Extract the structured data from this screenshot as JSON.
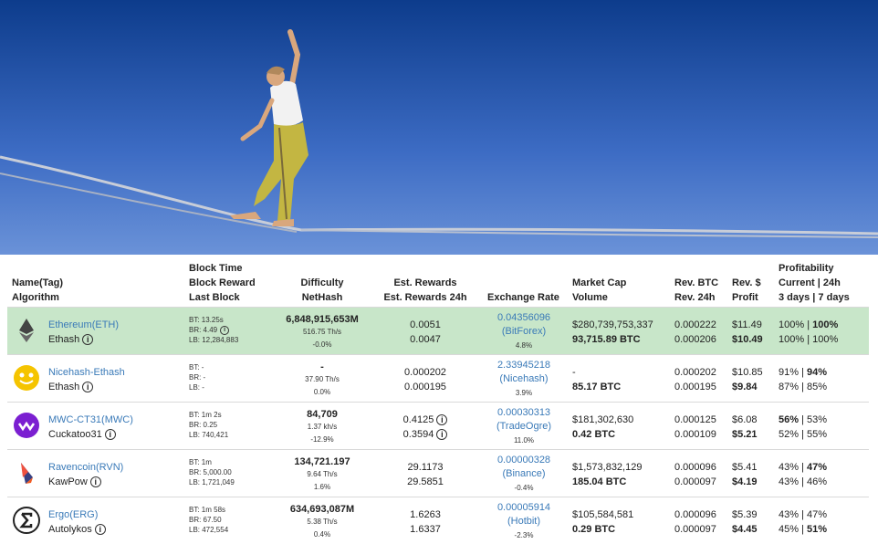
{
  "header": {
    "name_tag": "Name(Tag)",
    "algorithm": "Algorithm",
    "block_time": "Block Time",
    "block_reward": "Block Reward",
    "last_block": "Last Block",
    "difficulty": "Difficulty",
    "nethash": "NetHash",
    "est_rewards": "Est. Rewards",
    "est_rewards_24h": "Est. Rewards 24h",
    "exchange_rate": "Exchange Rate",
    "market_cap": "Market Cap",
    "volume": "Volume",
    "rev_btc": "Rev. BTC",
    "rev_24h": "Rev. 24h",
    "rev_usd": "Rev. $",
    "profit": "Profit",
    "profitability": "Profitability",
    "current_24h": "Current | 24h",
    "days_3_7": "3 days | 7 days"
  },
  "rows": [
    {
      "name": "Ethereum(ETH)",
      "algo": "Ethash",
      "icon": "ethereum-icon",
      "bt": "BT: 13.25s",
      "br": "BR: 4.49",
      "lb": "LB: 12,284,883",
      "difficulty": "6,848,915,653M",
      "nethash": "516.75 Th/s",
      "diff_change": "-0.0%",
      "est": "0.0051",
      "est24": "0.0047",
      "rate": "0.04356096",
      "exchange": "(BitForex)",
      "rate_change": "4.8%",
      "mcap": "$280,739,753,337",
      "volume": "93,715.89 BTC",
      "rev_btc": "0.000222",
      "rev_btc24": "0.000206",
      "rev_usd": "$11.49",
      "profit": "$10.49",
      "p_cur": "100%",
      "p_24": "100%",
      "p_3": "100%",
      "p_7": "100%"
    },
    {
      "name": "Nicehash-Ethash",
      "algo": "Ethash",
      "icon": "nicehash-icon",
      "bt": "BT: -",
      "br": "BR: -",
      "lb": "LB: -",
      "difficulty": "-",
      "nethash": "37.90 Th/s",
      "diff_change": "0.0%",
      "est": "0.000202",
      "est24": "0.000195",
      "rate": "2.33945218",
      "exchange": "(Nicehash)",
      "rate_change": "3.9%",
      "mcap": "-",
      "volume": "85.17 BTC",
      "rev_btc": "0.000202",
      "rev_btc24": "0.000195",
      "rev_usd": "$10.85",
      "profit": "$9.84",
      "p_cur": "91%",
      "p_24": "94%",
      "p_3": "87%",
      "p_7": "85%"
    },
    {
      "name": "MWC-CT31(MWC)",
      "algo": "Cuckatoo31",
      "icon": "mimblewimble-icon",
      "bt": "BT: 1m 2s",
      "br": "BR: 0.25",
      "lb": "LB: 740,421",
      "difficulty": "84,709",
      "nethash": "1.37 kh/s",
      "diff_change": "-12.9%",
      "est": "0.4125",
      "est24": "0.3594",
      "rate": "0.00030313",
      "exchange": "(TradeOgre)",
      "rate_change": "11.0%",
      "mcap": "$181,302,630",
      "volume": "0.42 BTC",
      "rev_btc": "0.000125",
      "rev_btc24": "0.000109",
      "rev_usd": "$6.08",
      "profit": "$5.21",
      "p_cur": "56%",
      "p_24": "53%",
      "p_3": "52%",
      "p_7": "55%"
    },
    {
      "name": "Ravencoin(RVN)",
      "algo": "KawPow",
      "icon": "ravencoin-icon",
      "bt": "BT: 1m",
      "br": "BR: 5,000.00",
      "lb": "LB: 1,721,049",
      "difficulty": "134,721.197",
      "nethash": "9.64 Th/s",
      "diff_change": "1.6%",
      "est": "29.1173",
      "est24": "29.5851",
      "rate": "0.00000328",
      "exchange": "(Binance)",
      "rate_change": "-0.4%",
      "mcap": "$1,573,832,129",
      "volume": "185.04 BTC",
      "rev_btc": "0.000096",
      "rev_btc24": "0.000097",
      "rev_usd": "$5.41",
      "profit": "$4.19",
      "p_cur": "43%",
      "p_24": "47%",
      "p_3": "43%",
      "p_7": "46%"
    },
    {
      "name": "Ergo(ERG)",
      "algo": "Autolykos",
      "icon": "ergo-icon",
      "bt": "BT: 1m 58s",
      "br": "BR: 67.50",
      "lb": "LB: 472,554",
      "difficulty": "634,693,087M",
      "nethash": "5.38 Th/s",
      "diff_change": "0.4%",
      "est": "1.6263",
      "est24": "1.6337",
      "rate": "0.00005914",
      "exchange": "(Hotbit)",
      "rate_change": "-2.3%",
      "mcap": "$105,584,581",
      "volume": "0.29 BTC",
      "rev_btc": "0.000096",
      "rev_btc24": "0.000097",
      "rev_usd": "$5.39",
      "profit": "$4.45",
      "p_cur": "43%",
      "p_24": "47%",
      "p_3": "45%",
      "p_7": "51%"
    }
  ]
}
